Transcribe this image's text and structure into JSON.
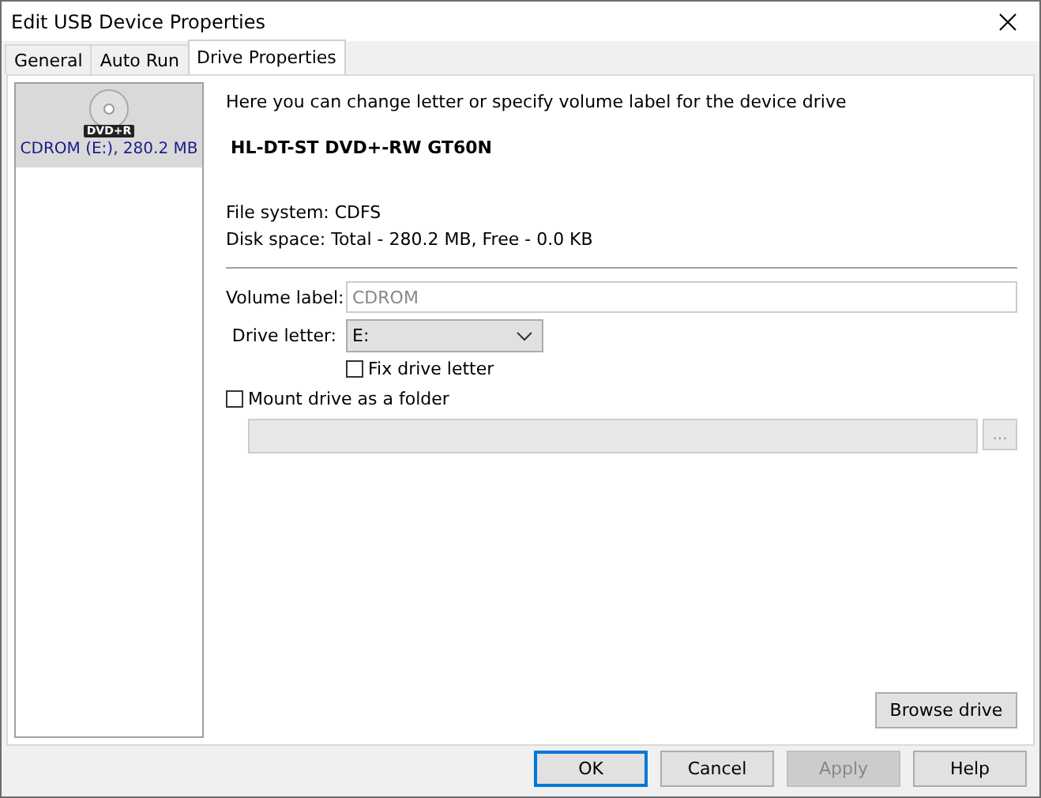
{
  "window": {
    "title": "Edit USB Device Properties"
  },
  "tabs": [
    {
      "label": "General",
      "selected": false
    },
    {
      "label": "Auto Run",
      "selected": false
    },
    {
      "label": "Drive Properties",
      "selected": true
    }
  ],
  "devices": [
    {
      "label": "CDROM (E:), 280.2 MB",
      "badge": "DVD+R",
      "selected": true
    }
  ],
  "description": "Here you can change letter or specify volume label for the device drive",
  "model": "HL-DT-ST DVD+-RW GT60N",
  "file_system": "File system: CDFS",
  "disk_space": "Disk space: Total - 280.2 MB, Free - 0.0 KB",
  "volume_label": {
    "label": "Volume label:",
    "value": "CDROM",
    "disabled": true
  },
  "drive_letter": {
    "label": "Drive letter:",
    "value": "E:"
  },
  "fix_drive_letter": {
    "label": "Fix drive letter",
    "checked": false
  },
  "mount_as_folder": {
    "label": "Mount drive as a folder",
    "checked": false
  },
  "folder_path": {
    "browse": "...",
    "disabled": true
  },
  "browse_drive": "Browse drive",
  "buttons": [
    {
      "label": "OK",
      "default": true,
      "disabled": false
    },
    {
      "label": "Cancel",
      "default": false,
      "disabled": false
    },
    {
      "label": "Apply",
      "default": false,
      "disabled": true
    },
    {
      "label": "Help",
      "default": false,
      "disabled": false
    }
  ]
}
